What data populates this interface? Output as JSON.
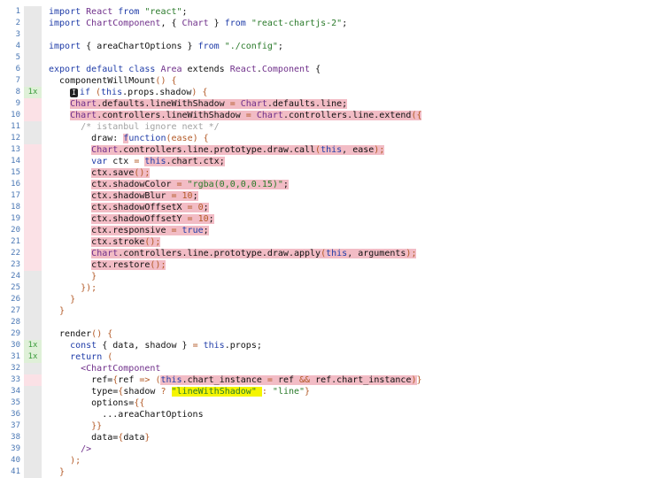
{
  "editor": {
    "lines": [
      {
        "n": "1",
        "cov": "",
        "st": "",
        "seg": [
          [
            "import ",
            1
          ],
          [
            "React",
            3
          ],
          [
            " from ",
            1
          ],
          [
            "\"react\"",
            2
          ],
          [
            ";",
            0
          ]
        ]
      },
      {
        "n": "2",
        "cov": "",
        "st": "",
        "seg": [
          [
            "import ",
            1
          ],
          [
            "ChartComponent",
            3
          ],
          [
            ", { ",
            0
          ],
          [
            "Chart",
            3
          ],
          [
            " } ",
            0
          ],
          [
            "from ",
            1
          ],
          [
            "\"react-chartjs-2\"",
            2
          ],
          [
            ";",
            0
          ]
        ]
      },
      {
        "n": "3",
        "cov": "",
        "st": "",
        "seg": []
      },
      {
        "n": "4",
        "cov": "",
        "st": "",
        "seg": [
          [
            "import ",
            1
          ],
          [
            "{ areaChartOptions } ",
            0
          ],
          [
            "from ",
            1
          ],
          [
            "\"./config\"",
            2
          ],
          [
            ";",
            0
          ]
        ]
      },
      {
        "n": "5",
        "cov": "",
        "st": "",
        "seg": []
      },
      {
        "n": "6",
        "cov": "",
        "st": "",
        "seg": [
          [
            "export default class ",
            1
          ],
          [
            "Area",
            3
          ],
          [
            " extends ",
            0
          ],
          [
            "React",
            3
          ],
          [
            ".",
            0
          ],
          [
            "Component",
            3
          ],
          [
            " {",
            0
          ]
        ]
      },
      {
        "n": "7",
        "cov": "",
        "st": "",
        "seg": [
          [
            "  componentWillMount",
            0
          ],
          [
            "() {",
            5
          ]
        ]
      },
      {
        "n": "8",
        "cov": "1x",
        "st": "hit",
        "seg": [
          [
            "    ",
            0
          ],
          [
            "I",
            0,
            "badge"
          ],
          [
            "if ",
            1
          ],
          [
            "(",
            5
          ],
          [
            "this",
            1
          ],
          [
            ".props.shadow",
            0
          ],
          [
            ") {",
            5
          ]
        ]
      },
      {
        "n": "9",
        "cov": "",
        "st": "miss",
        "seg": [
          [
            "    ",
            0
          ],
          [
            "Chart",
            3,
            "hl"
          ],
          [
            ".defaults.lineWithShadow ",
            0,
            "hl"
          ],
          [
            "= ",
            5,
            "hl"
          ],
          [
            "Chart",
            3,
            "hl"
          ],
          [
            ".defaults.line;",
            0,
            "hl"
          ]
        ]
      },
      {
        "n": "10",
        "cov": "",
        "st": "miss",
        "seg": [
          [
            "    ",
            0
          ],
          [
            "Chart",
            3,
            "hl"
          ],
          [
            ".controllers.lineWithShadow ",
            0,
            "hl"
          ],
          [
            "= ",
            5,
            "hl"
          ],
          [
            "Chart",
            3,
            "hl"
          ],
          [
            ".controllers.line.extend",
            0,
            "hl"
          ],
          [
            "({",
            5,
            "hl"
          ]
        ]
      },
      {
        "n": "11",
        "cov": "",
        "st": "",
        "seg": [
          [
            "      /* istanbul ignore next */",
            4
          ]
        ]
      },
      {
        "n": "12",
        "cov": "",
        "st": "",
        "seg": [
          [
            "        draw: ",
            0
          ],
          [
            "f",
            1,
            "hl"
          ],
          [
            "unction",
            1
          ],
          [
            "(ease) {",
            5
          ]
        ]
      },
      {
        "n": "13",
        "cov": "",
        "st": "miss",
        "seg": [
          [
            "        ",
            0
          ],
          [
            "Chart",
            3,
            "hl"
          ],
          [
            ".controllers.line.prototype.draw.call",
            0,
            "hl"
          ],
          [
            "(",
            5,
            "hl"
          ],
          [
            "this",
            1,
            "hl"
          ],
          [
            ", ease",
            0,
            "hl"
          ],
          [
            ");",
            5,
            "hl"
          ]
        ]
      },
      {
        "n": "14",
        "cov": "",
        "st": "miss",
        "seg": [
          [
            "        ",
            0
          ],
          [
            "var ",
            1
          ],
          [
            "ctx ",
            0
          ],
          [
            "= ",
            5
          ],
          [
            "this",
            1,
            "hl"
          ],
          [
            ".chart.ctx",
            0,
            "hl"
          ],
          [
            ";",
            0,
            "hl"
          ]
        ]
      },
      {
        "n": "15",
        "cov": "",
        "st": "miss",
        "seg": [
          [
            "        ",
            0
          ],
          [
            "ctx.save",
            0,
            "hl"
          ],
          [
            "();",
            5,
            "hl"
          ]
        ]
      },
      {
        "n": "16",
        "cov": "",
        "st": "miss",
        "seg": [
          [
            "        ",
            0
          ],
          [
            "ctx.shadowColor ",
            0,
            "hl"
          ],
          [
            "= ",
            5,
            "hl"
          ],
          [
            "\"rgba(0,0,0,0.15)\"",
            2,
            "hl"
          ],
          [
            ";",
            0,
            "hl"
          ]
        ]
      },
      {
        "n": "17",
        "cov": "",
        "st": "miss",
        "seg": [
          [
            "        ",
            0
          ],
          [
            "ctx.shadowBlur ",
            0,
            "hl"
          ],
          [
            "= 10",
            5,
            "hl"
          ],
          [
            ";",
            0,
            "hl"
          ]
        ]
      },
      {
        "n": "18",
        "cov": "",
        "st": "miss",
        "seg": [
          [
            "        ",
            0
          ],
          [
            "ctx.shadowOffsetX ",
            0,
            "hl"
          ],
          [
            "= 0",
            5,
            "hl"
          ],
          [
            ";",
            0,
            "hl"
          ]
        ]
      },
      {
        "n": "19",
        "cov": "",
        "st": "miss",
        "seg": [
          [
            "        ",
            0
          ],
          [
            "ctx.shadowOffsetY ",
            0,
            "hl"
          ],
          [
            "= 10",
            5,
            "hl"
          ],
          [
            ";",
            0,
            "hl"
          ]
        ]
      },
      {
        "n": "20",
        "cov": "",
        "st": "miss",
        "seg": [
          [
            "        ",
            0
          ],
          [
            "ctx.responsive ",
            0,
            "hl"
          ],
          [
            "= ",
            5,
            "hl"
          ],
          [
            "true",
            1,
            "hl"
          ],
          [
            ";",
            0,
            "hl"
          ]
        ]
      },
      {
        "n": "21",
        "cov": "",
        "st": "miss",
        "seg": [
          [
            "        ",
            0
          ],
          [
            "ctx.stroke",
            0,
            "hl"
          ],
          [
            "();",
            5,
            "hl"
          ]
        ]
      },
      {
        "n": "22",
        "cov": "",
        "st": "miss",
        "seg": [
          [
            "        ",
            0
          ],
          [
            "Chart",
            3,
            "hl"
          ],
          [
            ".controllers.line.prototype.draw.apply",
            0,
            "hl"
          ],
          [
            "(",
            5,
            "hl"
          ],
          [
            "this",
            1,
            "hl"
          ],
          [
            ", arguments",
            0,
            "hl"
          ],
          [
            ");",
            5,
            "hl"
          ]
        ]
      },
      {
        "n": "23",
        "cov": "",
        "st": "miss",
        "seg": [
          [
            "        ",
            0
          ],
          [
            "ctx.restore",
            0,
            "hl"
          ],
          [
            "();",
            5,
            "hl"
          ]
        ]
      },
      {
        "n": "24",
        "cov": "",
        "st": "",
        "seg": [
          [
            "        }",
            5
          ]
        ]
      },
      {
        "n": "25",
        "cov": "",
        "st": "",
        "seg": [
          [
            "      });",
            5
          ]
        ]
      },
      {
        "n": "26",
        "cov": "",
        "st": "",
        "seg": [
          [
            "    }",
            5
          ]
        ]
      },
      {
        "n": "27",
        "cov": "",
        "st": "",
        "seg": [
          [
            "  }",
            5
          ]
        ]
      },
      {
        "n": "28",
        "cov": "",
        "st": "",
        "seg": []
      },
      {
        "n": "29",
        "cov": "",
        "st": "",
        "seg": [
          [
            "  render",
            0
          ],
          [
            "() {",
            5
          ]
        ]
      },
      {
        "n": "30",
        "cov": "1x",
        "st": "hit",
        "seg": [
          [
            "    ",
            0
          ],
          [
            "const ",
            1
          ],
          [
            "{ data, shadow } ",
            0
          ],
          [
            "= ",
            5
          ],
          [
            "this",
            1
          ],
          [
            ".props;",
            0
          ]
        ]
      },
      {
        "n": "31",
        "cov": "1x",
        "st": "hit",
        "seg": [
          [
            "    ",
            0
          ],
          [
            "return ",
            1
          ],
          [
            "(",
            5
          ]
        ]
      },
      {
        "n": "32",
        "cov": "",
        "st": "",
        "seg": [
          [
            "      ",
            0
          ],
          [
            "<ChartComponent",
            3
          ]
        ]
      },
      {
        "n": "33",
        "cov": "",
        "st": "miss",
        "seg": [
          [
            "        ref=",
            0
          ],
          [
            "{",
            5
          ],
          [
            "ref ",
            0
          ],
          [
            "=> ",
            5
          ],
          [
            "(",
            5
          ],
          [
            "this",
            1,
            "hl"
          ],
          [
            ".chart_instance ",
            0,
            "hl"
          ],
          [
            "= ",
            5,
            "hl"
          ],
          [
            "ref ",
            0,
            "hl"
          ],
          [
            "&& ",
            5,
            "hl"
          ],
          [
            "ref.chart_instance",
            0,
            "hl"
          ],
          [
            ")",
            5,
            "hl"
          ],
          [
            "}",
            5
          ]
        ]
      },
      {
        "n": "34",
        "cov": "",
        "st": "",
        "seg": [
          [
            "        type=",
            0
          ],
          [
            "{",
            5
          ],
          [
            "shadow ",
            0
          ],
          [
            "? ",
            5
          ],
          [
            "\"lineWithShadow\" ",
            2,
            "yel"
          ],
          [
            ": ",
            5
          ],
          [
            "\"line\"",
            2
          ],
          [
            "}",
            5
          ]
        ]
      },
      {
        "n": "35",
        "cov": "",
        "st": "",
        "seg": [
          [
            "        options=",
            0
          ],
          [
            "{{",
            5
          ]
        ]
      },
      {
        "n": "36",
        "cov": "",
        "st": "",
        "seg": [
          [
            "          ...areaChartOptions",
            0
          ]
        ]
      },
      {
        "n": "37",
        "cov": "",
        "st": "",
        "seg": [
          [
            "        }}",
            5
          ]
        ]
      },
      {
        "n": "38",
        "cov": "",
        "st": "",
        "seg": [
          [
            "        data=",
            0
          ],
          [
            "{",
            5
          ],
          [
            "data",
            0
          ],
          [
            "}",
            5
          ]
        ]
      },
      {
        "n": "39",
        "cov": "",
        "st": "",
        "seg": [
          [
            "      />",
            3
          ]
        ]
      },
      {
        "n": "40",
        "cov": "",
        "st": "",
        "seg": [
          [
            "    );",
            5
          ]
        ]
      },
      {
        "n": "41",
        "cov": "",
        "st": "",
        "seg": [
          [
            "  }",
            5
          ]
        ]
      }
    ]
  },
  "colors": {
    "keyword": "#1f3ca8",
    "string": "#2a7a2a",
    "ident": "#6f2f8a",
    "comment": "#a2a2a2",
    "uncovered": "#f2bcc5",
    "covered": "#dff0d8",
    "yellow": "#f5f500"
  }
}
